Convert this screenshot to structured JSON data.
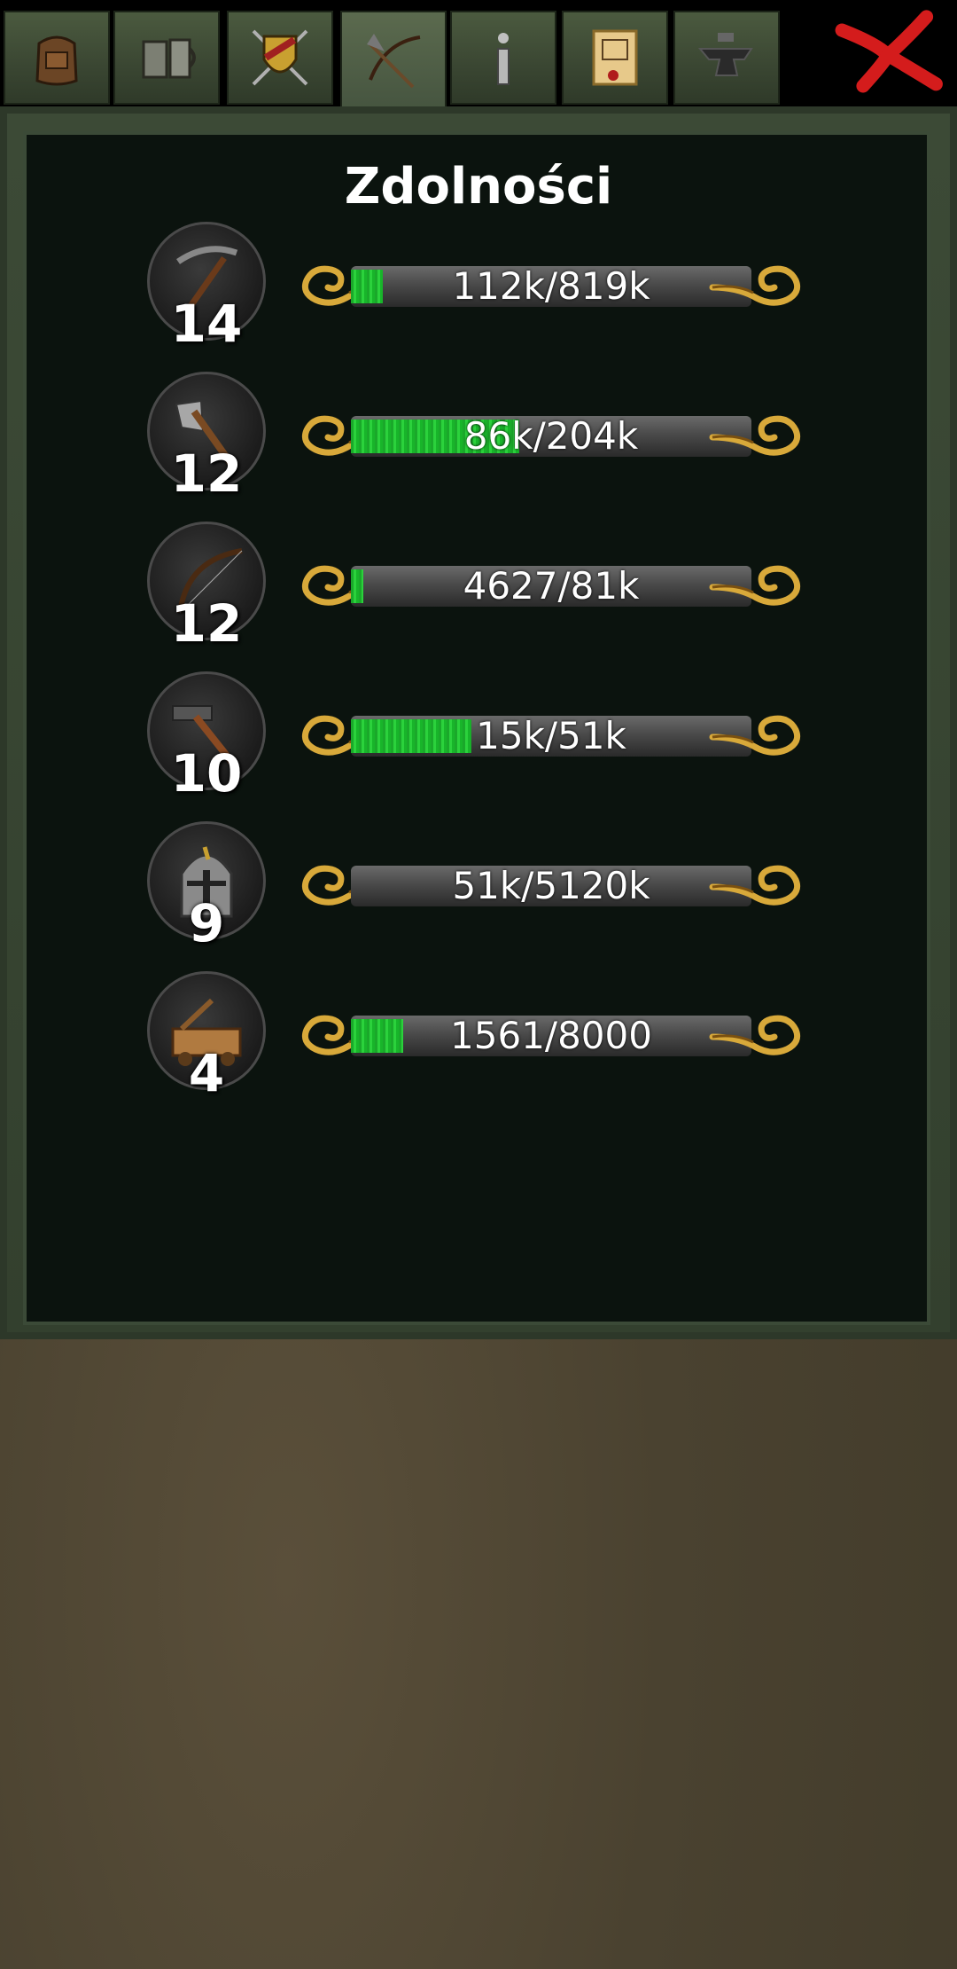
{
  "tabs": [
    {
      "name": "backpack-tab",
      "icon": "backpack-icon",
      "active": false
    },
    {
      "name": "tavern-tab",
      "icon": "tankard-icon",
      "active": false
    },
    {
      "name": "guild-tab",
      "icon": "shield-icon",
      "active": false
    },
    {
      "name": "skills-tab",
      "icon": "pickaxe-bow-icon",
      "active": true
    },
    {
      "name": "info-tab",
      "icon": "info-icon",
      "active": false
    },
    {
      "name": "quests-tab",
      "icon": "scroll-icon",
      "active": false
    },
    {
      "name": "crafting-tab",
      "icon": "anvil-icon",
      "active": false
    }
  ],
  "panel": {
    "title": "Zdolności"
  },
  "skills": [
    {
      "icon": "pickaxe-icon",
      "level": "14",
      "progress_text": "112k/819k",
      "progress": 0.08
    },
    {
      "icon": "axe-icon",
      "level": "12",
      "progress_text": "86k/204k",
      "progress": 0.42
    },
    {
      "icon": "bow-icon",
      "level": "12",
      "progress_text": "4627/81k",
      "progress": 0.03
    },
    {
      "icon": "hammer-icon",
      "level": "10",
      "progress_text": "15k/51k",
      "progress": 0.3
    },
    {
      "icon": "helmet-icon",
      "level": "9",
      "progress_text": "51k/5120k",
      "progress": 0.0
    },
    {
      "icon": "siege-engine-icon",
      "level": "4",
      "progress_text": "1561/8000",
      "progress": 0.13
    }
  ],
  "colors": {
    "close_x": "#d41c1c",
    "bar_fill": "#22c133",
    "ornament_gold": "#d8a93a"
  }
}
